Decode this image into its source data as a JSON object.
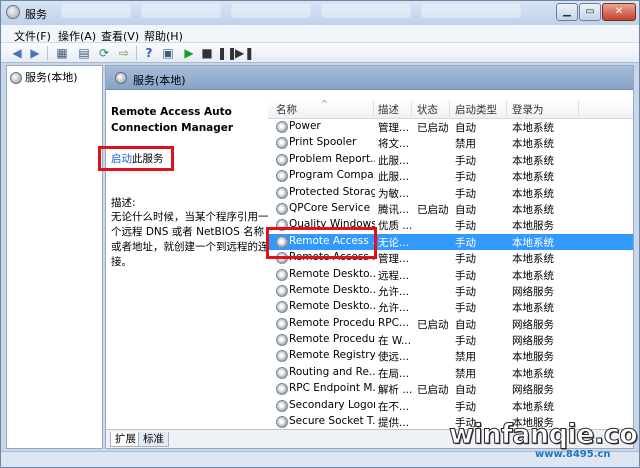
{
  "window": {
    "title": "服务"
  },
  "menubar": {
    "items": [
      "文件(F)",
      "操作(A)",
      "查看(V)",
      "帮助(H)"
    ]
  },
  "toolbar": {
    "icons": [
      "back-arrow-icon",
      "forward-arrow-icon",
      "show-tree-icon",
      "properties-icon",
      "refresh-icon",
      "export-icon",
      "help-icon",
      "console-icon",
      "start-icon",
      "stop-icon",
      "pause-icon",
      "restart-icon"
    ]
  },
  "tree": {
    "root_label": "服务(本地)"
  },
  "content": {
    "header_title": "服务(本地)",
    "description": {
      "service_name": "Remote Access Auto Connection Manager",
      "start_link": "启动",
      "start_suffix": "此服务",
      "label": "描述:",
      "text": "无论什么时候，当某个程序引用一个远程 DNS 或者 NetBIOS 名称或者地址，就创建一个到远程的连接。"
    },
    "list": {
      "columns": [
        "名称",
        "描述",
        "状态",
        "启动类型",
        "登录为"
      ],
      "rows": [
        {
          "name": "Power",
          "desc": "管理...",
          "status": "已启动",
          "startup": "自动",
          "logon": "本地系统"
        },
        {
          "name": "Print Spooler",
          "desc": "将文...",
          "status": "",
          "startup": "禁用",
          "logon": "本地系统"
        },
        {
          "name": "Problem Report...",
          "desc": "此服...",
          "status": "",
          "startup": "手动",
          "logon": "本地系统"
        },
        {
          "name": "Program Compa...",
          "desc": "此服...",
          "status": "",
          "startup": "手动",
          "logon": "本地系统"
        },
        {
          "name": "Protected Storage",
          "desc": "为敏...",
          "status": "",
          "startup": "手动",
          "logon": "本地系统"
        },
        {
          "name": "QPCore Service",
          "desc": "腾讯...",
          "status": "已启动",
          "startup": "自动",
          "logon": "本地系统"
        },
        {
          "name": "Quality Windows ...",
          "desc": "优质 ...",
          "status": "",
          "startup": "手动",
          "logon": "本地服务"
        },
        {
          "name": "Remote Access ...",
          "desc": "无论...",
          "status": "",
          "startup": "手动",
          "logon": "本地系统",
          "selected": true
        },
        {
          "name": "Remote Access ...",
          "desc": "管理...",
          "status": "",
          "startup": "手动",
          "logon": "本地系统"
        },
        {
          "name": "Remote Deskto...",
          "desc": "远程...",
          "status": "",
          "startup": "手动",
          "logon": "本地系统"
        },
        {
          "name": "Remote Deskto...",
          "desc": "允许...",
          "status": "",
          "startup": "手动",
          "logon": "网络服务"
        },
        {
          "name": "Remote Deskto...",
          "desc": "允许...",
          "status": "",
          "startup": "手动",
          "logon": "本地系统"
        },
        {
          "name": "Remote Procedu...",
          "desc": "RPC...",
          "status": "已启动",
          "startup": "自动",
          "logon": "网络服务"
        },
        {
          "name": "Remote Procedu...",
          "desc": "在 W...",
          "status": "",
          "startup": "手动",
          "logon": "网络服务"
        },
        {
          "name": "Remote Registry",
          "desc": "使远...",
          "status": "",
          "startup": "禁用",
          "logon": "本地服务"
        },
        {
          "name": "Routing and Re...",
          "desc": "在局...",
          "status": "",
          "startup": "禁用",
          "logon": "本地系统"
        },
        {
          "name": "RPC Endpoint M...",
          "desc": "解析 ...",
          "status": "已启动",
          "startup": "自动",
          "logon": "网络服务"
        },
        {
          "name": "Secondary Logon",
          "desc": "在不...",
          "status": "",
          "startup": "手动",
          "logon": "本地系统"
        },
        {
          "name": "Secure Socket T...",
          "desc": "提供...",
          "status": "",
          "startup": "手动",
          "logon": "本地服务"
        }
      ]
    },
    "tabs": [
      "扩展",
      "标准"
    ]
  },
  "watermark": {
    "text": "winfanqie.com",
    "sub": "www.8495.cn"
  },
  "colors": {
    "selection": "#3399ff",
    "highlight_box": "#e2101a",
    "link": "#1a5ec6"
  }
}
